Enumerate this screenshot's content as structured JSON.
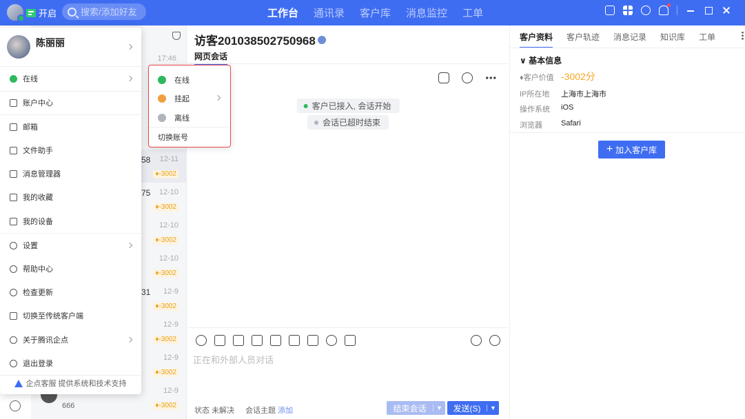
{
  "colors": {
    "brand": "#3f6df2",
    "online": "#2eb85c",
    "away": "#f0a040",
    "offline": "#b0b4bc",
    "value": "#f5a623",
    "highlight_border": "#e8464a"
  },
  "topbar": {
    "open_label": "开启",
    "search_placeholder": "搜索/添加好友",
    "tabs": [
      "工作台",
      "通讯录",
      "客户库",
      "消息监控",
      "工单"
    ]
  },
  "sessions": {
    "first_time": "17:46",
    "items": [
      {
        "num": "58",
        "time": "12-11",
        "badge": "-3002"
      },
      {
        "num": "75",
        "time": "12-10",
        "badge": "-3002"
      },
      {
        "num": "",
        "time": "12-10",
        "badge": "-3002"
      },
      {
        "num": "",
        "time": "12-10",
        "badge": "-3002"
      },
      {
        "num": "31",
        "time": "12-9",
        "badge": "-3002"
      },
      {
        "num": "",
        "time": "12-9",
        "badge": "-3002"
      },
      {
        "num": "",
        "time": "12-9",
        "badge": "-3002"
      },
      {
        "num": "",
        "time": "12-9",
        "badge": "-3002",
        "msg": "666"
      }
    ]
  },
  "chat": {
    "title": "访客201038502750968",
    "tab": "网页会话",
    "sys_messages": [
      "客户已接入, 会话开始",
      "会话已超时结束"
    ],
    "input_placeholder": "正在和外部人员对话",
    "status_label": "状态",
    "status_value": "未解决",
    "topic_label": "会话主题",
    "topic_action": "添加",
    "end_button": "结束会话",
    "send_button": "发送(S)"
  },
  "right": {
    "tabs": [
      "客户资料",
      "客户轨迹",
      "消息记录",
      "知识库",
      "工单"
    ],
    "section": "基本信息",
    "value_label": "客户价值",
    "value": "-3002分",
    "ip_label": "IP所在地",
    "ip": "上海市上海市",
    "os_label": "操作系统",
    "os": "iOS",
    "browser_label": "浏览器",
    "browser": "Safari",
    "add_button": "加入客户库"
  },
  "menu": {
    "user_name": "陈丽丽",
    "status": "在线",
    "items": [
      "账户中心",
      "邮箱",
      "文件助手",
      "消息管理器",
      "我的收藏",
      "我的设备",
      "设置",
      "帮助中心",
      "检查更新",
      "切换至传统客户端",
      "关于腾讯企点",
      "退出登录"
    ],
    "footer": "企点客服 提供系统和技术支持"
  },
  "status_menu": {
    "online": "在线",
    "away": "挂起",
    "offline": "离线",
    "switch": "切换账号"
  }
}
